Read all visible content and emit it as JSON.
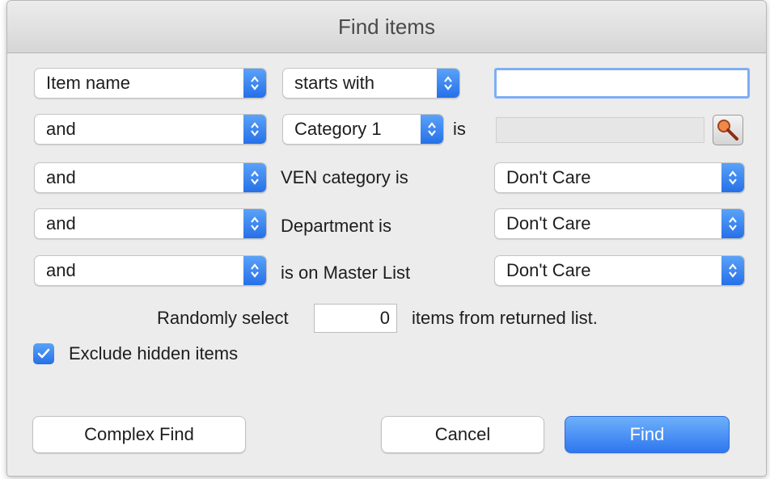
{
  "window": {
    "title": "Find items"
  },
  "rows": [
    {
      "conjunction": "Item name",
      "operator": "starts with",
      "value": ""
    },
    {
      "conjunction": "and",
      "category": "Category 1",
      "is_label": "is",
      "value": ""
    },
    {
      "conjunction": "and",
      "label": "VEN category is",
      "value": "Don't Care"
    },
    {
      "conjunction": "and",
      "label": "Department is",
      "value": "Don't Care"
    },
    {
      "conjunction": "and",
      "label": "is on Master List",
      "value": "Don't Care"
    }
  ],
  "random": {
    "prefix": "Randomly select",
    "count": "0",
    "suffix": "items from returned list."
  },
  "exclude_hidden": {
    "label": "Exclude hidden items",
    "checked": true
  },
  "buttons": {
    "complex_find": "Complex Find",
    "cancel": "Cancel",
    "find": "Find"
  },
  "colors": {
    "accent": "#2f77ef",
    "window_bg": "#ececec"
  },
  "icons": {
    "popup_arrows": "chevron-up-down-icon",
    "lookup": "magnifier-icon",
    "checkbox": "checkmark-icon"
  }
}
